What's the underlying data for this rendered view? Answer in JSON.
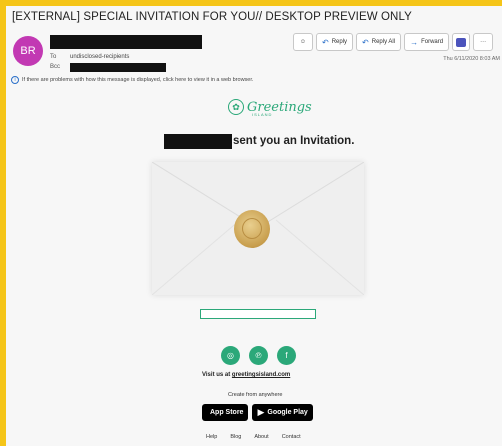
{
  "email": {
    "subject": "[EXTERNAL] SPECIAL INVITATION FOR YOU// DESKTOP PREVIEW ONLY",
    "avatar_initials": "BR",
    "to_label": "To",
    "to_value": "undisclosed-recipients",
    "bcc_label": "Bcc",
    "info_bar": "If there are problems with how this message is displayed, click here to view it in a web browser.",
    "timestamp": "Thu 6/11/2020 8:03 AM"
  },
  "toolbar": {
    "reply_label": "Reply",
    "reply_all_label": "Reply All",
    "forward_label": "Forward",
    "more_label": "···"
  },
  "body": {
    "logo_text": "Greetings",
    "logo_sub": "ISLAND",
    "invite_text": "sent you an Invitation.",
    "visit_prefix": "Visit us at",
    "visit_link": "greetingsisland.com",
    "create_text": "Create from anywhere",
    "app_store_label": "App Store",
    "google_play_label": "Google Play",
    "footer_links": [
      "Help",
      "Blog",
      "About",
      "Contact"
    ]
  },
  "colors": {
    "border": "#f5c518",
    "accent_green": "#2ba879",
    "avatar_bg": "#c239b3",
    "teams_purple": "#4b53bc"
  }
}
